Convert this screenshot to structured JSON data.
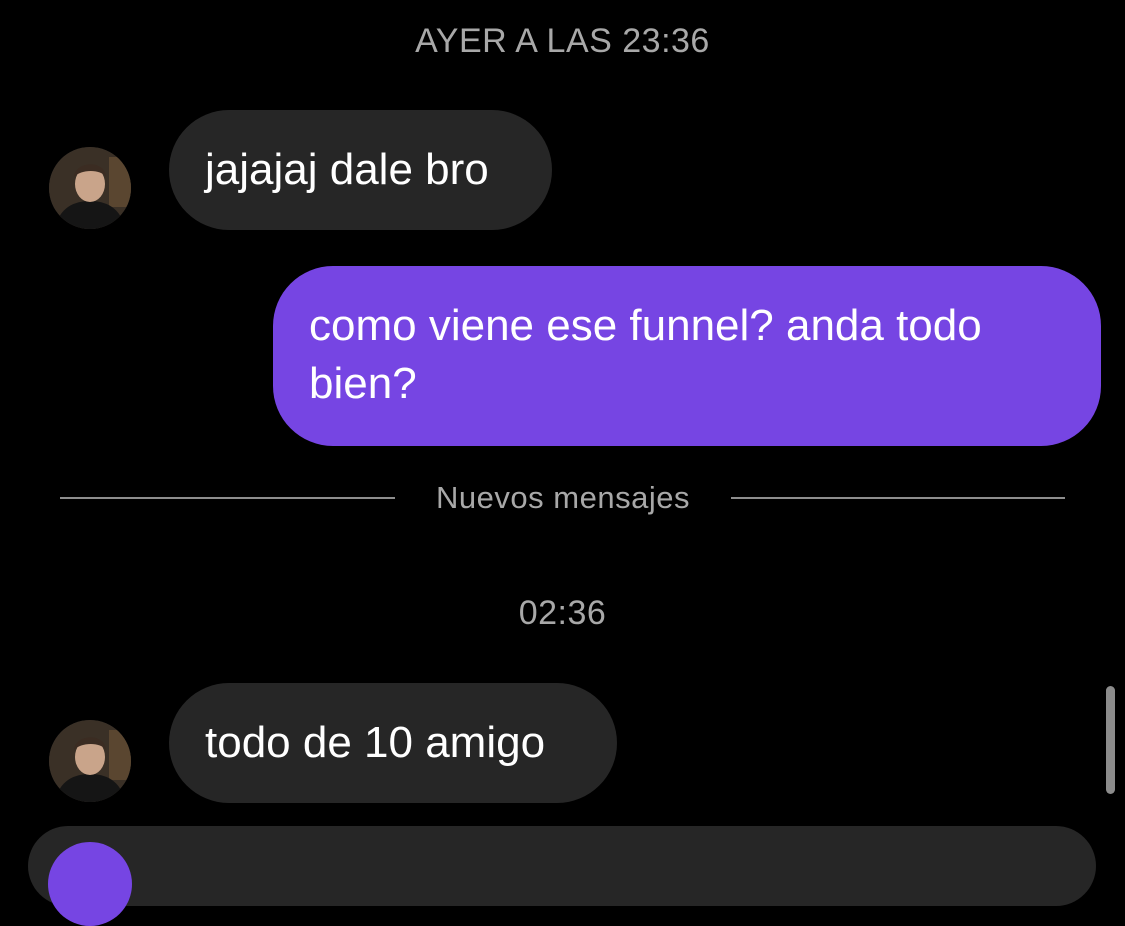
{
  "thread": {
    "timestamp_1": "AYER A LAS 23:36",
    "timestamp_2": "02:36",
    "new_messages_label": "Nuevos mensajes",
    "messages": [
      {
        "sender": "contact",
        "text": "jajajaj dale bro"
      },
      {
        "sender": "me",
        "text": "como viene ese funnel? anda todo bien?"
      },
      {
        "sender": "contact",
        "text": "todo de 10 amigo"
      }
    ]
  },
  "colors": {
    "background": "#000000",
    "incoming_bubble": "#262626",
    "outgoing_bubble": "#7645e3",
    "secondary_text": "#a8a8a8"
  },
  "icons": {
    "contact_avatar": "contact-avatar",
    "camera_button": "camera-icon"
  }
}
